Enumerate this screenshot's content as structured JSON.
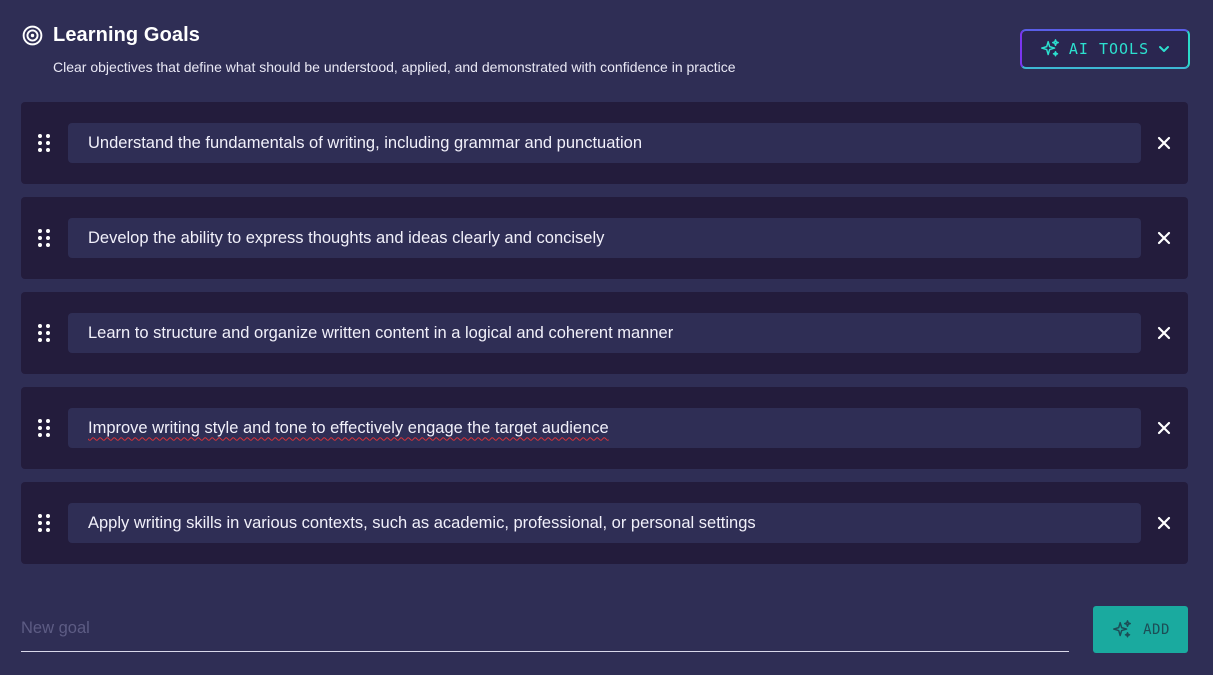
{
  "header": {
    "title": "Learning Goals",
    "subtitle": "Clear objectives that define what should be understood, applied, and demonstrated with confidence in practice",
    "title_icon": "target-icon"
  },
  "ai_tools": {
    "label": "AI TOOLS",
    "icon": "sparkles-icon",
    "dropdown_icon": "chevron-down-icon"
  },
  "goals": [
    {
      "text": "Understand the fundamentals of writing, including grammar and punctuation"
    },
    {
      "text": "Develop the ability to express thoughts and ideas clearly and concisely"
    },
    {
      "text": "Learn to structure and organize written content in a logical and coherent manner"
    },
    {
      "text": "Improve writing style and tone to effectively engage the target audience"
    },
    {
      "text": "Apply writing skills in various contexts, such as academic, professional, or personal settings"
    }
  ],
  "new_goal": {
    "placeholder": "New goal",
    "value": ""
  },
  "add_button": {
    "label": "ADD",
    "icon": "sparkles-icon"
  },
  "colors": {
    "background": "#2f2e55",
    "row_background": "#231c3c",
    "accent_teal": "#2ce0cf",
    "add_button": "#1aaa9f"
  }
}
